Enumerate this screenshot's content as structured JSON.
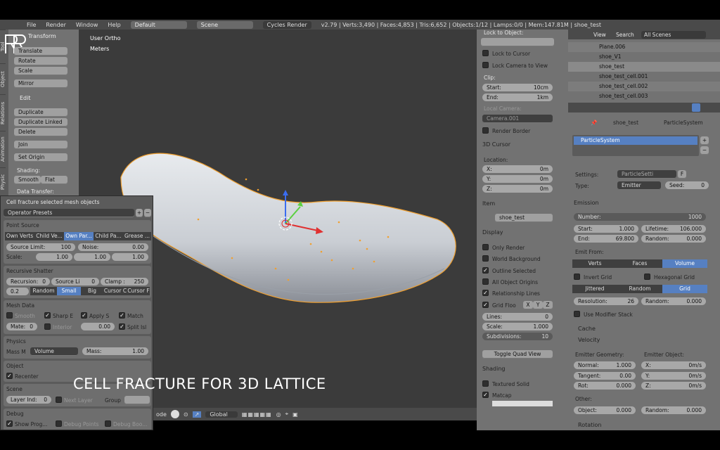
{
  "menubar": {
    "items": [
      "File",
      "Render",
      "Window",
      "Help"
    ],
    "layout": "Default",
    "scene": "Scene",
    "engine": "Cycles Render",
    "stats": "v2.79 | Verts:3,490 | Faces:4,853 | Tris:6,652 | Objects:1/12 | Lamps:0/0 | Mem:147.81M | shoe_test"
  },
  "viewport": {
    "view_name": "User Ortho",
    "units": "Meters",
    "caption": "CELL FRACTURE FOR 3D LATTICE"
  },
  "toolshelf": {
    "tabs": [
      "Tool",
      "Object",
      "Relations",
      "Animation",
      "Physic"
    ],
    "transform_header": "Transform",
    "buttons": [
      "Translate",
      "Rotate",
      "Scale",
      "Mirror"
    ],
    "edit_header": "Edit",
    "edit_buttons": [
      "Duplicate",
      "Duplicate Linked",
      "Delete",
      "Join"
    ],
    "set_origin": "Set Origin",
    "shading_label": "Shading:",
    "smooth": "Smooth",
    "flat": "Flat",
    "data_transfer": "Data Transfer:"
  },
  "operator": {
    "title": "Cell fracture selected mesh objects",
    "presets": "Operator Presets",
    "point_source": {
      "header": "Point Source",
      "options": [
        "Own Verts",
        "Child Ve...",
        "Own Par...",
        "Child Pa...",
        "Grease ..."
      ],
      "active_index": 2,
      "source_limit_label": "Source Limit:",
      "source_limit": "100",
      "noise_label": "Noise:",
      "noise": "0.00",
      "scale_label": "Scale:",
      "scale": [
        "1.00",
        "1.00",
        "1.00"
      ]
    },
    "recursive": {
      "header": "Recursive Shatter",
      "recursion_label": "Recursion:",
      "recursion": "0",
      "source_li": "Source Li",
      "source_li_val": "0",
      "clamp_label": "Clamp :",
      "clamp": "250",
      "val": "0.2",
      "modes": [
        "Random",
        "Small",
        "Big"
      ],
      "active_mode": 1,
      "cursor": "Cursor C",
      "cursor_f": "Cursor F"
    },
    "mesh_data": {
      "header": "Mesh Data",
      "smooth": "Smooth",
      "sharp": "Sharp E",
      "apply": "Apply S",
      "match": "Match",
      "mate_label": "Mate:",
      "mate": "0",
      "interior": "Interior",
      "margin": "0.00",
      "split": "Split Isl"
    },
    "physics": {
      "header": "Physics",
      "mass_mode_label": "Mass M",
      "mass_mode": "Volume",
      "mass_label": "Mass:",
      "mass": "1.00"
    },
    "object": {
      "header": "Object",
      "recenter": "Recenter"
    },
    "scene": {
      "header": "Scene",
      "layer_label": "Layer Ind:",
      "layer": "0",
      "next_layer": "Next Layer",
      "group": "Group"
    },
    "debug": {
      "header": "Debug",
      "show_prog": "Show Prog...",
      "debug_points": "Debug Points",
      "debug_bool": "Debug Boo..."
    }
  },
  "bottombar": {
    "mode": "ode",
    "orientation": "Global"
  },
  "npanel": {
    "lock_to_object": "Lock to Object:",
    "lock_to_cursor": "Lock to Cursor",
    "lock_camera": "Lock Camera to View",
    "clip": "Clip:",
    "clip_start_label": "Start:",
    "clip_start": "10cm",
    "clip_end_label": "End:",
    "clip_end": "1km",
    "local_camera": "Local Camera:",
    "camera": "Camera.001",
    "render_border": "Render Border",
    "cursor_header": "3D Cursor",
    "location": "Location:",
    "x_label": "X:",
    "x": "0m",
    "y_label": "Y:",
    "y": "0m",
    "z_label": "Z:",
    "z": "0m",
    "item_header": "Item",
    "item_name": "shoe_test",
    "display_header": "Display",
    "only_render": "Only Render",
    "world_background": "World Background",
    "outline_selected": "Outline Selected",
    "all_origins": "All Object Origins",
    "relationship_lines": "Relationship Lines",
    "grid_floor": "Grid Floo",
    "axes": [
      "X",
      "Y",
      "Z"
    ],
    "lines_label": "Lines:",
    "lines": "0",
    "scale_label": "Scale:",
    "scale": "1.000",
    "subdiv_label": "Subdivisions:",
    "subdiv": "10",
    "quad_view": "Toggle Quad View",
    "shading_header": "Shading",
    "textured_solid": "Textured Solid",
    "matcap": "Matcap"
  },
  "outliner": {
    "view": "View",
    "search": "Search",
    "filter": "All Scenes",
    "rows": [
      "Plane.006",
      "shoe_V1",
      "shoe_test",
      "shoe_test_cell.001",
      "shoe_test_cell.002",
      "shoe_test_cell.003"
    ]
  },
  "properties": {
    "breadcrumb_obj": "shoe_test",
    "breadcrumb_ps": "ParticleSystem",
    "system_name": "ParticleSystem",
    "settings_label": "Settings:",
    "settings_value": "ParticleSetti",
    "settings_users": "F",
    "type_label": "Type:",
    "type_value": "Emitter",
    "seed_label": "Seed:",
    "seed": "0",
    "emission_header": "Emission",
    "number_label": "Number:",
    "number": "1000",
    "start_label": "Start:",
    "start": "1.000",
    "lifetime_label": "Lifetime:",
    "lifetime": "106.000",
    "end_label": "End:",
    "end": "69.800",
    "random_label": "Random:",
    "random": "0.000",
    "emit_from": "Emit From:",
    "emit_options": [
      "Verts",
      "Faces",
      "Volume"
    ],
    "emit_active": 2,
    "invert_grid": "Invert Grid",
    "hex_grid": "Hexagonal Grid",
    "dist_options": [
      "Jittered",
      "Random",
      "Grid"
    ],
    "dist_active": 2,
    "resolution_label": "Resolution:",
    "resolution": "26",
    "random2_label": "Random:",
    "random2": "0.000",
    "modifier_stack": "Use Modifier Stack",
    "cache_header": "Cache",
    "velocity_header": "Velocity",
    "emitter_geometry": "Emitter Geometry:",
    "emitter_object": "Emitter Object:",
    "normal_label": "Normal:",
    "normal": "1.000",
    "tangent_label": "Tangent:",
    "tangent": "0.00",
    "rot_label": "Rot:",
    "rot": "0.000",
    "ex_label": "X:",
    "ex": "0m/s",
    "ey_label": "Y:",
    "ey": "0m/s",
    "ez_label": "Z:",
    "ez": "0m/s",
    "other": "Other:",
    "object_label": "Object:",
    "object": "0.000",
    "random3_label": "Random:",
    "random3": "0.000",
    "rotation_header": "Rotation"
  }
}
